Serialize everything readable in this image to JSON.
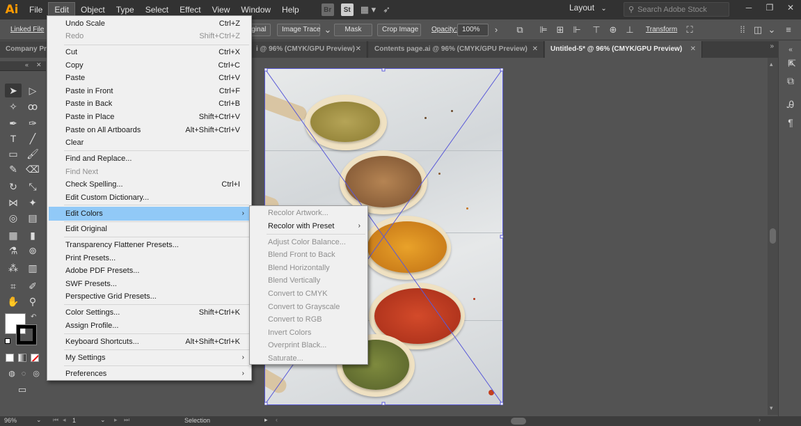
{
  "menubar": {
    "logo": "Ai",
    "items": [
      "File",
      "Edit",
      "Object",
      "Type",
      "Select",
      "Effect",
      "View",
      "Window",
      "Help"
    ],
    "bridge_badge": "Br",
    "stock_badge": "St",
    "layout_label": "Layout",
    "search_placeholder": "Search Adobe Stock"
  },
  "controlbar": {
    "linked_file": "Linked File",
    "original": "iginal",
    "image_trace": "Image Trace",
    "mask": "Mask",
    "crop_image": "Crop Image",
    "opacity_label": "Opacity:",
    "opacity_value": "100%",
    "transform": "Transform"
  },
  "tabs": [
    {
      "label": "Company Pr",
      "active": false
    },
    {
      "label": "i @ 96% (CMYK/GPU Preview)",
      "active": false
    },
    {
      "label": "Contents page.ai @ 96% (CMYK/GPU Preview)",
      "active": false
    },
    {
      "label": "Untitled-5* @ 96% (CMYK/GPU Preview)",
      "active": true
    }
  ],
  "edit_menu": {
    "items": [
      {
        "label": "Undo Scale",
        "shortcut": "Ctrl+Z",
        "disabled": false
      },
      {
        "label": "Redo",
        "shortcut": "Shift+Ctrl+Z",
        "disabled": true
      },
      {
        "label": "Cut",
        "shortcut": "Ctrl+X",
        "disabled": false
      },
      {
        "label": "Copy",
        "shortcut": "Ctrl+C",
        "disabled": false
      },
      {
        "label": "Paste",
        "shortcut": "Ctrl+V",
        "disabled": false
      },
      {
        "label": "Paste in Front",
        "shortcut": "Ctrl+F",
        "disabled": false
      },
      {
        "label": "Paste in Back",
        "shortcut": "Ctrl+B",
        "disabled": false
      },
      {
        "label": "Paste in Place",
        "shortcut": "Shift+Ctrl+V",
        "disabled": false
      },
      {
        "label": "Paste on All Artboards",
        "shortcut": "Alt+Shift+Ctrl+V",
        "disabled": false
      },
      {
        "label": "Clear",
        "shortcut": "",
        "disabled": false
      },
      {
        "label": "Find and Replace...",
        "shortcut": "",
        "disabled": false
      },
      {
        "label": "Find Next",
        "shortcut": "",
        "disabled": true
      },
      {
        "label": "Check Spelling...",
        "shortcut": "Ctrl+I",
        "disabled": false
      },
      {
        "label": "Edit Custom Dictionary...",
        "shortcut": "",
        "disabled": false
      },
      {
        "label": "Edit Colors",
        "shortcut": "",
        "disabled": false
      },
      {
        "label": "Edit Original",
        "shortcut": "",
        "disabled": false
      },
      {
        "label": "Transparency Flattener Presets...",
        "shortcut": "",
        "disabled": false
      },
      {
        "label": "Print Presets...",
        "shortcut": "",
        "disabled": false
      },
      {
        "label": "Adobe PDF Presets...",
        "shortcut": "",
        "disabled": false
      },
      {
        "label": "SWF Presets...",
        "shortcut": "",
        "disabled": false
      },
      {
        "label": "Perspective Grid Presets...",
        "shortcut": "",
        "disabled": false
      },
      {
        "label": "Color Settings...",
        "shortcut": "Shift+Ctrl+K",
        "disabled": false
      },
      {
        "label": "Assign Profile...",
        "shortcut": "",
        "disabled": false
      },
      {
        "label": "Keyboard Shortcuts...",
        "shortcut": "Alt+Shift+Ctrl+K",
        "disabled": false
      },
      {
        "label": "My Settings",
        "shortcut": "",
        "disabled": false
      },
      {
        "label": "Preferences",
        "shortcut": "",
        "disabled": false
      }
    ]
  },
  "edit_colors_submenu": {
    "items": [
      {
        "label": "Recolor Artwork...",
        "disabled": true
      },
      {
        "label": "Recolor with Preset",
        "disabled": false
      },
      {
        "label": "Adjust Color Balance...",
        "disabled": true
      },
      {
        "label": "Blend Front to Back",
        "disabled": true
      },
      {
        "label": "Blend Horizontally",
        "disabled": true
      },
      {
        "label": "Blend Vertically",
        "disabled": true
      },
      {
        "label": "Convert to CMYK",
        "disabled": true
      },
      {
        "label": "Convert to Grayscale",
        "disabled": true
      },
      {
        "label": "Convert to RGB",
        "disabled": true
      },
      {
        "label": "Invert Colors",
        "disabled": true
      },
      {
        "label": "Overprint Black...",
        "disabled": true
      },
      {
        "label": "Saturate...",
        "disabled": true
      }
    ]
  },
  "statusbar": {
    "zoom": "96%",
    "artboard_number": "1",
    "tool_name": "Selection"
  },
  "colors": {
    "highlight": "#91c9f7",
    "menu_bg": "#f0f0f0",
    "app_bg": "#535353",
    "logo": "#ff9a00",
    "selection_box": "#5a5ad8"
  }
}
